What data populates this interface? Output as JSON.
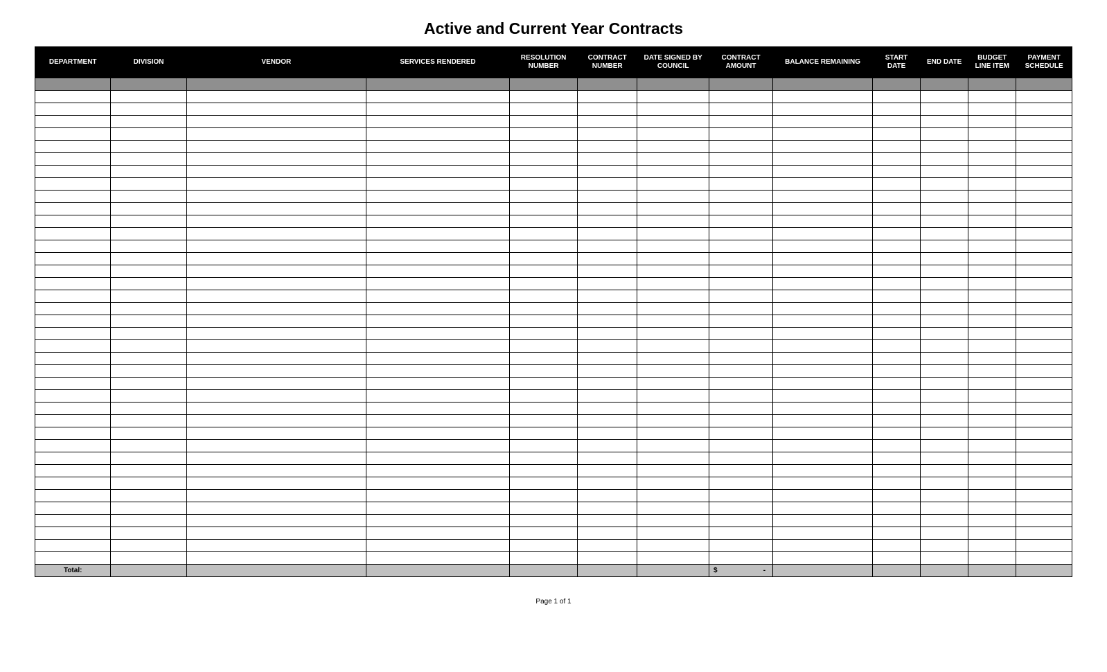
{
  "title": "Active and Current Year Contracts",
  "columns": [
    "DEPARTMENT",
    "DIVISION",
    "VENDOR",
    "SERVICES RENDERED",
    "RESOLUTION NUMBER",
    "CONTRACT NUMBER",
    "DATE SIGNED BY COUNCIL",
    "CONTRACT AMOUNT",
    "BALANCE REMAINING",
    "START DATE",
    "END DATE",
    "BUDGET LINE ITEM",
    "PAYMENT SCHEDULE"
  ],
  "empty_row_count": 38,
  "totals": {
    "label": "Total:",
    "amount_prefix": "$",
    "amount_value": "-"
  },
  "footer": "Page 1 of 1"
}
